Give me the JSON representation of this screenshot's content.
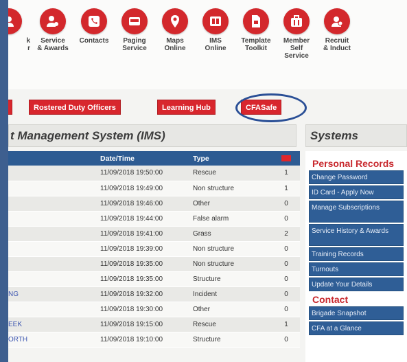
{
  "icon_bar": [
    {
      "label": "k\nr",
      "icon": "user-icon"
    },
    {
      "label": "Service\n& Awards",
      "icon": "service-awards-icon"
    },
    {
      "label": "Contacts",
      "icon": "phone-icon"
    },
    {
      "label": "Paging\nService",
      "icon": "pager-icon"
    },
    {
      "label": "Maps\nOnline",
      "icon": "map-pin-icon"
    },
    {
      "label": "IMS\nOnline",
      "icon": "ims-icon"
    },
    {
      "label": "Template\nToolkit",
      "icon": "document-icon"
    },
    {
      "label": "Member\nSelf\nService",
      "icon": "briefcase-icon"
    },
    {
      "label": "Recruit\n& Induct",
      "icon": "recruit-icon"
    }
  ],
  "buttons": {
    "rostered": "Rostered Duty Officers",
    "learning": "Learning Hub",
    "cfasafe": "CFASafe"
  },
  "main_title": "t Management System (IMS)",
  "table": {
    "headers": {
      "date": "Date/Time",
      "type": "Type"
    },
    "rows": [
      {
        "name": "",
        "date": "11/09/2018 19:50:00",
        "type": "Rescue",
        "count": "1"
      },
      {
        "name": "",
        "date": "11/09/2018 19:49:00",
        "type": "Non structure",
        "count": "1"
      },
      {
        "name": "",
        "date": "11/09/2018 19:46:00",
        "type": "Other",
        "count": "0"
      },
      {
        "name": "",
        "date": "11/09/2018 19:44:00",
        "type": "False alarm",
        "count": "0"
      },
      {
        "name": "",
        "date": "11/09/2018 19:41:00",
        "type": "Grass",
        "count": "2"
      },
      {
        "name": "",
        "date": "11/09/2018 19:39:00",
        "type": "Non structure",
        "count": "0"
      },
      {
        "name": "",
        "date": "11/09/2018 19:35:00",
        "type": "Non structure",
        "count": "0"
      },
      {
        "name": "",
        "date": "11/09/2018 19:35:00",
        "type": "Structure",
        "count": "0"
      },
      {
        "name": "NG",
        "date": "11/09/2018 19:32:00",
        "type": "Incident",
        "count": "0"
      },
      {
        "name": "",
        "date": "11/09/2018 19:30:00",
        "type": "Other",
        "count": "0"
      },
      {
        "name": "EEK",
        "date": "11/09/2018 19:15:00",
        "type": "Rescue",
        "count": "1"
      },
      {
        "name": "ORTH",
        "date": "11/09/2018 19:10:00",
        "type": "Structure",
        "count": "0"
      }
    ]
  },
  "systems": {
    "title": "Systems",
    "personal_heading": "Personal Records",
    "links": [
      "Change Password",
      "ID Card - Apply Now",
      "Manage Subscriptions",
      "Service History & Awards",
      "Training Records",
      "Turnouts",
      "Update Your Details"
    ],
    "contact_heading": "Contact",
    "contact_links": [
      "Brigade Snapshot",
      "CFA at a Glance"
    ]
  },
  "colors": {
    "accent_red": "#d8262d",
    "header_blue": "#2d5b92",
    "ring_blue": "#2a4f96"
  }
}
